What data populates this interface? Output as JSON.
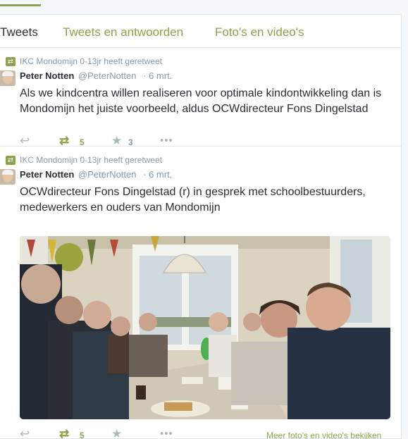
{
  "tabs": [
    {
      "label": "Tweets"
    },
    {
      "label": "Tweets en antwoorden"
    },
    {
      "label": "Foto's en video's"
    }
  ],
  "tweets": [
    {
      "retweeted_by": "IKC Mondomijn 0-13jr heeft geretweet",
      "fullname": "Peter Notten",
      "username": "@PeterNotten",
      "time": "· 6 mrt.",
      "text": "Als we kindcentra willen realiseren voor optimale kindontwikkeling dan is Mondomijn het juiste voorbeeld, aldus OCWdirecteur Fons Dingelstad",
      "retweets": "5",
      "favorites": "3"
    },
    {
      "retweeted_by": "IKC Mondomijn 0-13jr heeft geretweet",
      "fullname": "Peter Notten",
      "username": "@PeterNotten",
      "time": "· 6 mrt.",
      "text": "OCWdirecteur Fons Dingelstad (r) in gesprek met schoolbestuurders, medewerkers en ouders van Mondomijn",
      "retweets": "5",
      "favorites": "",
      "more_media": "Meer foto's en video's bekijken"
    }
  ],
  "icons": {
    "reply": "reply-icon",
    "retweet": "retweet-icon",
    "favorite": "star-icon",
    "more": "more-icon"
  },
  "colors": {
    "accent": "#8ba34a",
    "muted": "#8899a6",
    "text": "#292f33"
  }
}
